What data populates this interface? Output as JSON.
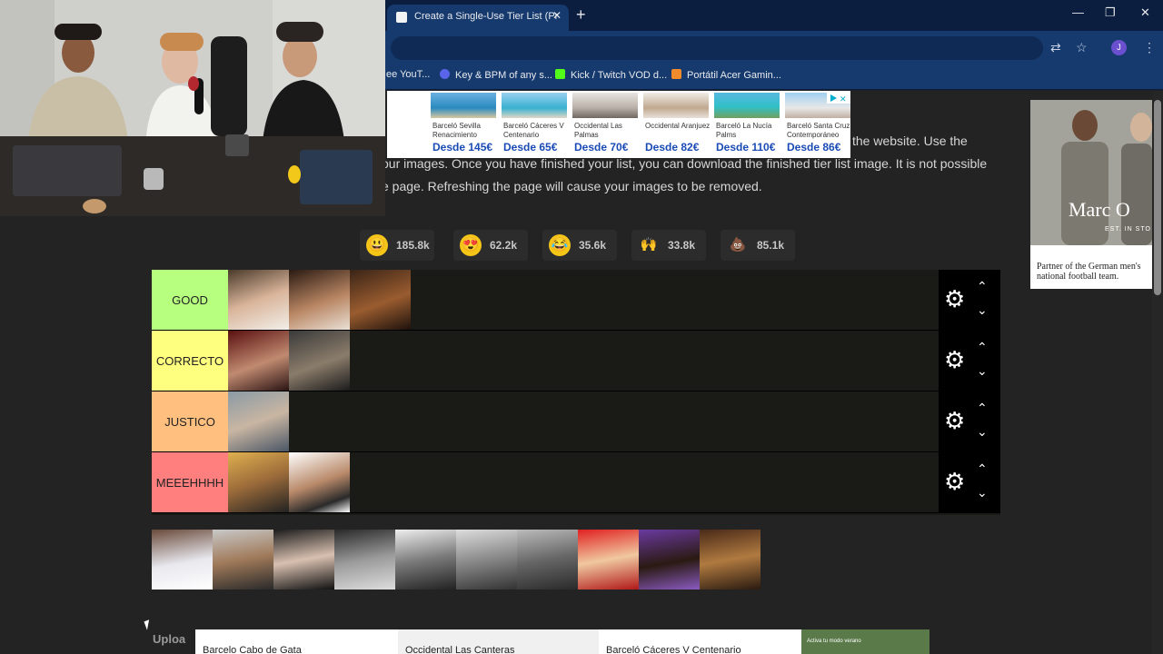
{
  "browser": {
    "tab_title": "Create a Single-Use Tier List (Pr",
    "tab_close": "✕",
    "new_tab": "+",
    "window_buttons": [
      "—",
      "❐",
      "✕"
    ],
    "toolbar_icons": [
      "translate-icon",
      "star-icon",
      "profile-avatar",
      "kebab-menu-icon"
    ],
    "avatar_letter": "J",
    "bookmarks": [
      {
        "label": "ee YouT...",
        "color": "#163a6e"
      },
      {
        "label": "Key & BPM of any s...",
        "color": "#5a64e8"
      },
      {
        "label": "Kick / Twitch VOD d...",
        "color": "#53fc18"
      },
      {
        "label": "Portátil Acer Gamin...",
        "color": "#f28b2c"
      }
    ]
  },
  "intro": {
    "line1": "the website. Use the",
    "line2": "our images. Once you have finished your list, you can download the finished tier list image. It is not possible",
    "line3": "e page. Refreshing the page will cause your images to be removed."
  },
  "reactions": [
    {
      "emoji": "😃",
      "count": "185.8k",
      "color": "#f5c518"
    },
    {
      "emoji": "😍",
      "count": "62.2k",
      "color": "#f5c518"
    },
    {
      "emoji": "😂",
      "count": "35.6k",
      "color": "#f5c518"
    },
    {
      "emoji": "🙌",
      "count": "33.8k",
      "color": "#2c2c2c"
    },
    {
      "emoji": "💩",
      "count": "85.1k",
      "color": "#2c2c2c"
    }
  ],
  "tiers": [
    {
      "label": "GOOD",
      "color": "#b7ff7f",
      "items": 3
    },
    {
      "label": "CORRECTO",
      "color": "#ffff7f",
      "items": 2
    },
    {
      "label": "JUSTICO",
      "color": "#ffbf7f",
      "items": 1
    },
    {
      "label": "MEEEHHHH",
      "color": "#ff7f7f",
      "items": 2
    }
  ],
  "tier_controls": {
    "gear": "⚙",
    "up": "⌃",
    "down": "⌄"
  },
  "pool_count": 10,
  "upload_label": "Uploa",
  "ad_top": [
    {
      "name": "Barceló Sevilla Renacimiento",
      "price": "Desde 145€"
    },
    {
      "name": "Barceló Cáceres V Centenario",
      "price": "Desde 65€"
    },
    {
      "name": "Occidental Las Palmas",
      "price": "Desde 70€"
    },
    {
      "name": "Occidental Aranjuez",
      "price": "Desde 82€"
    },
    {
      "name": "Barceló La Nucía Palms",
      "price": "Desde 110€"
    },
    {
      "name": "Barceló Santa Cruz Contemporáneo",
      "price": "Desde 86€"
    }
  ],
  "ad_right": {
    "brand": "Marc O",
    "est": "EST. IN STO",
    "copy": "Partner of the German men's national football team."
  },
  "ad_bottom": {
    "cards": [
      "Barcelo Cabo de Gata",
      "Occidental Las Canteras",
      "Barceló Cáceres V Centenario"
    ],
    "promo": "Activa tu modo verano"
  }
}
